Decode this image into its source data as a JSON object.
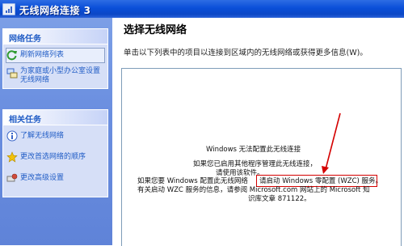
{
  "window": {
    "title": "无线网络连接 3"
  },
  "sidebar": {
    "network_tasks": {
      "header": "网络任务",
      "items": [
        {
          "label": "刷新网络列表"
        },
        {
          "label": "为家庭或小型办公室设置无线网络"
        }
      ]
    },
    "related_tasks": {
      "header": "相关任务",
      "items": [
        {
          "label": "了解无线网络"
        },
        {
          "label": "更改首选网络的顺序"
        },
        {
          "label": "更改高级设置"
        }
      ]
    }
  },
  "main": {
    "heading": "选择无线网络",
    "instruction": "单击以下列表中的项目以连接到区域内的无线网络或获得更多信息(W)。",
    "message": {
      "line1": "Windows 无法配置此无线连接",
      "line2": "如果您已启用其他程序管理此无线连接，",
      "line3": "请使用该软件。",
      "line4a": "如果您要 Windows 配置此无线网络",
      "line4b": "请启动 Windows 零配置 (WZC) 服务。",
      "line5": "有关启动 WZC 服务的信息，请参阅 Microsoft.com 网站上的 Microsoft 知",
      "line6": "识库文章 871122。"
    }
  },
  "colors": {
    "titlebar": "#0a4fd8",
    "link": "#215dc6",
    "highlight_box": "#d40000"
  }
}
